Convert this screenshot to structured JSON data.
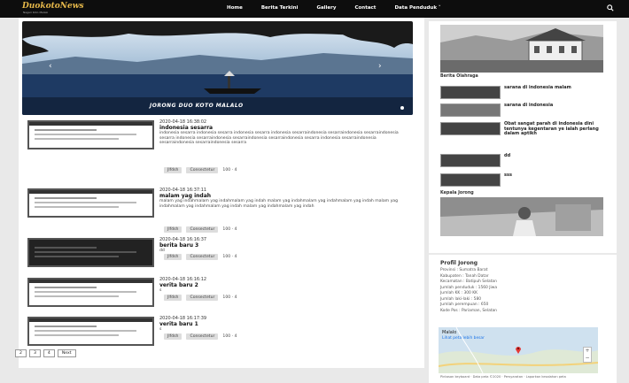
{
  "header": {
    "logo": "DuokotoNews",
    "logo_sub": "Nagari Koto Malalo",
    "nav": [
      "Home",
      "Berita Terkini",
      "Gallery",
      "Contact",
      "Data Penduduk ˅"
    ]
  },
  "slider": {
    "caption": "JORONG DUO KOTO MALALO"
  },
  "posts": [
    {
      "date": "2020-04-18 16:38:02",
      "title": "indonesia sesarra",
      "excerpt": "indonesia sesarra indonesia sesarra indonesia sesarra indonesia sesarraindonesia sesarraindonesia sesarraindonesia sesarra indonesia sesarraindonesia sesarraindonesia sesarraindonesia sesarra indonesia sesarraindonesia sesarraindonesia sesarraindonesia sesarra",
      "tag1": "Jlfdsh",
      "tag2": "Consectetur",
      "count": "100 · 4"
    },
    {
      "date": "2020-04-18 16:37:11",
      "title": "malam yag indah",
      "excerpt": "malam yag indahmalam yag indahmalam yag indah malam yag indahmalam yag indahmalam yag indah malam yag indahmalam yag indahmalam yag indah malam yag indahmalam yag indah",
      "tag1": "Jlfdsh",
      "tag2": "Consectetur",
      "count": "100 · 4"
    },
    {
      "date": "2020-04-18 16:16:37",
      "title": "berita baru 3",
      "excerpt": "dd",
      "tag1": "Jlfdsh",
      "tag2": "Consectetur",
      "count": "100 · 4"
    },
    {
      "date": "2020-04-18 16:16:12",
      "title": "verita baru 2",
      "excerpt": "s",
      "tag1": "Jlfdsh",
      "tag2": "Consectetur",
      "count": "100 · 4"
    },
    {
      "date": "2020-04-18 16:17:39",
      "title": "verita baru 1",
      "excerpt": "s",
      "tag1": "Jlfdsh",
      "tag2": "Consectetur",
      "count": "100 · 4"
    }
  ],
  "pagination": [
    "2",
    "3",
    "4",
    "Next"
  ],
  "sidebar": {
    "berita_title": "Berita Olahraga",
    "berita_items": [
      "sarana di indonesia malam",
      "sarana di indonesia",
      "Obat sangat parah di indonesia dini tentunya kegentaran ye ialah perlang dalam aptikh",
      "dd",
      "sss"
    ],
    "kepala_title": "Kepala Jorong",
    "profil_title": "Profil Jorong",
    "profil_items": [
      "Provinsi : Sumatra Barat",
      "Kabupaten : Tanah Datar",
      "Kecamatan : Batipuh Selatan",
      "Jumlah penduduk : 1560 Jiwa",
      "Jumlah KK : 300 KK",
      "Jumlah laki-laki : 580",
      "Jumlah perempuan : 650",
      "Kode Pos : Pariaman, Selatan"
    ],
    "map": {
      "place": "Malalo",
      "link": "Lihat peta lebih besar",
      "footer": "Pintasan keyboard · Data peta ©2020 · Persyaratan · Laporkan kesalahan peta"
    }
  },
  "colors": {
    "topbar": "#0d0d0d",
    "logo": "#e6b84a",
    "page_bg": "#e9e9e9"
  }
}
